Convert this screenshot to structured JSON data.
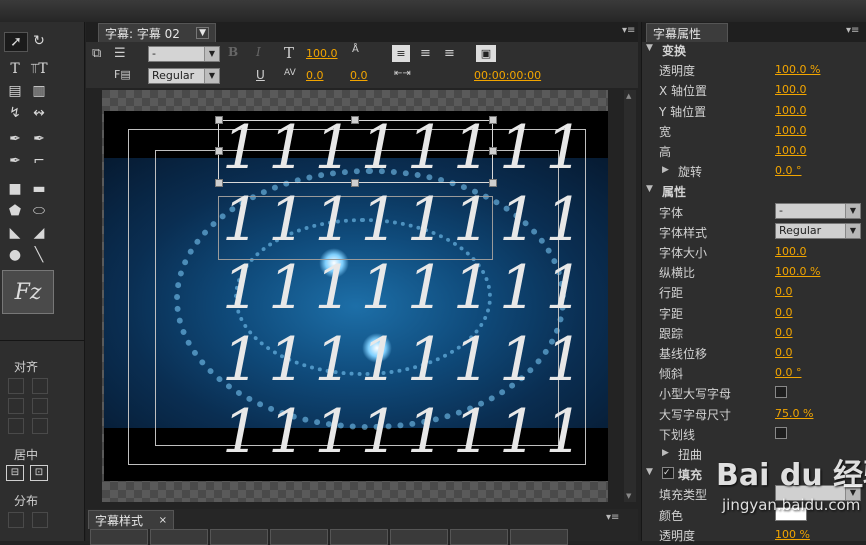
{
  "title_panel": {
    "tab_label": "字幕: 字幕 02"
  },
  "toolbar": {
    "font_dropdown": "-",
    "style_dropdown": "Regular",
    "font_size": "100.0",
    "kerning": "0.0",
    "leading": "0.0",
    "timecode": "00:00:00:00"
  },
  "canvas": {
    "text_rows": [
      "11111111",
      "11111111",
      "11111111",
      "11111111",
      "11111111"
    ]
  },
  "tools_panel": {
    "align_label": "对齐",
    "center_label": "居中",
    "distribute_label": "分布"
  },
  "styles_panel": {
    "tab_label": "字幕样式"
  },
  "properties_panel": {
    "tab_label": "字幕属性",
    "rows": [
      {
        "kind": "section",
        "label": "变换"
      },
      {
        "kind": "value",
        "label": "透明度",
        "value": "100.0 %"
      },
      {
        "kind": "value",
        "label": "X 轴位置",
        "value": "100.0"
      },
      {
        "kind": "value",
        "label": "Y 轴位置",
        "value": "100.0"
      },
      {
        "kind": "value",
        "label": "宽",
        "value": "100.0"
      },
      {
        "kind": "value",
        "label": "高",
        "value": "100.0"
      },
      {
        "kind": "sub",
        "label": "旋转",
        "value": "0.0 °"
      },
      {
        "kind": "section",
        "label": "属性"
      },
      {
        "kind": "dropdown",
        "label": "字体",
        "value": "-"
      },
      {
        "kind": "dropdown",
        "label": "字体样式",
        "value": "Regular"
      },
      {
        "kind": "value",
        "label": "字体大小",
        "value": "100.0"
      },
      {
        "kind": "value",
        "label": "纵横比",
        "value": "100.0 %"
      },
      {
        "kind": "value",
        "label": "行距",
        "value": "0.0"
      },
      {
        "kind": "value",
        "label": "字距",
        "value": "0.0"
      },
      {
        "kind": "value",
        "label": "跟踪",
        "value": "0.0"
      },
      {
        "kind": "value",
        "label": "基线位移",
        "value": "0.0"
      },
      {
        "kind": "value",
        "label": "倾斜",
        "value": "0.0 °"
      },
      {
        "kind": "check",
        "label": "小型大写字母"
      },
      {
        "kind": "value",
        "label": "大写字母尺寸",
        "value": "75.0 %"
      },
      {
        "kind": "check",
        "label": "下划线"
      },
      {
        "kind": "sub",
        "label": "扭曲"
      },
      {
        "kind": "checksection",
        "label": "填充"
      },
      {
        "kind": "dropdown",
        "label": "填充类型",
        "value": ""
      },
      {
        "kind": "color",
        "label": "颜色"
      },
      {
        "kind": "value",
        "label": "透明度",
        "value": "100 %"
      }
    ]
  },
  "watermark": {
    "brand": "Bai du 经验",
    "url": "jingyan.baidu.com"
  }
}
